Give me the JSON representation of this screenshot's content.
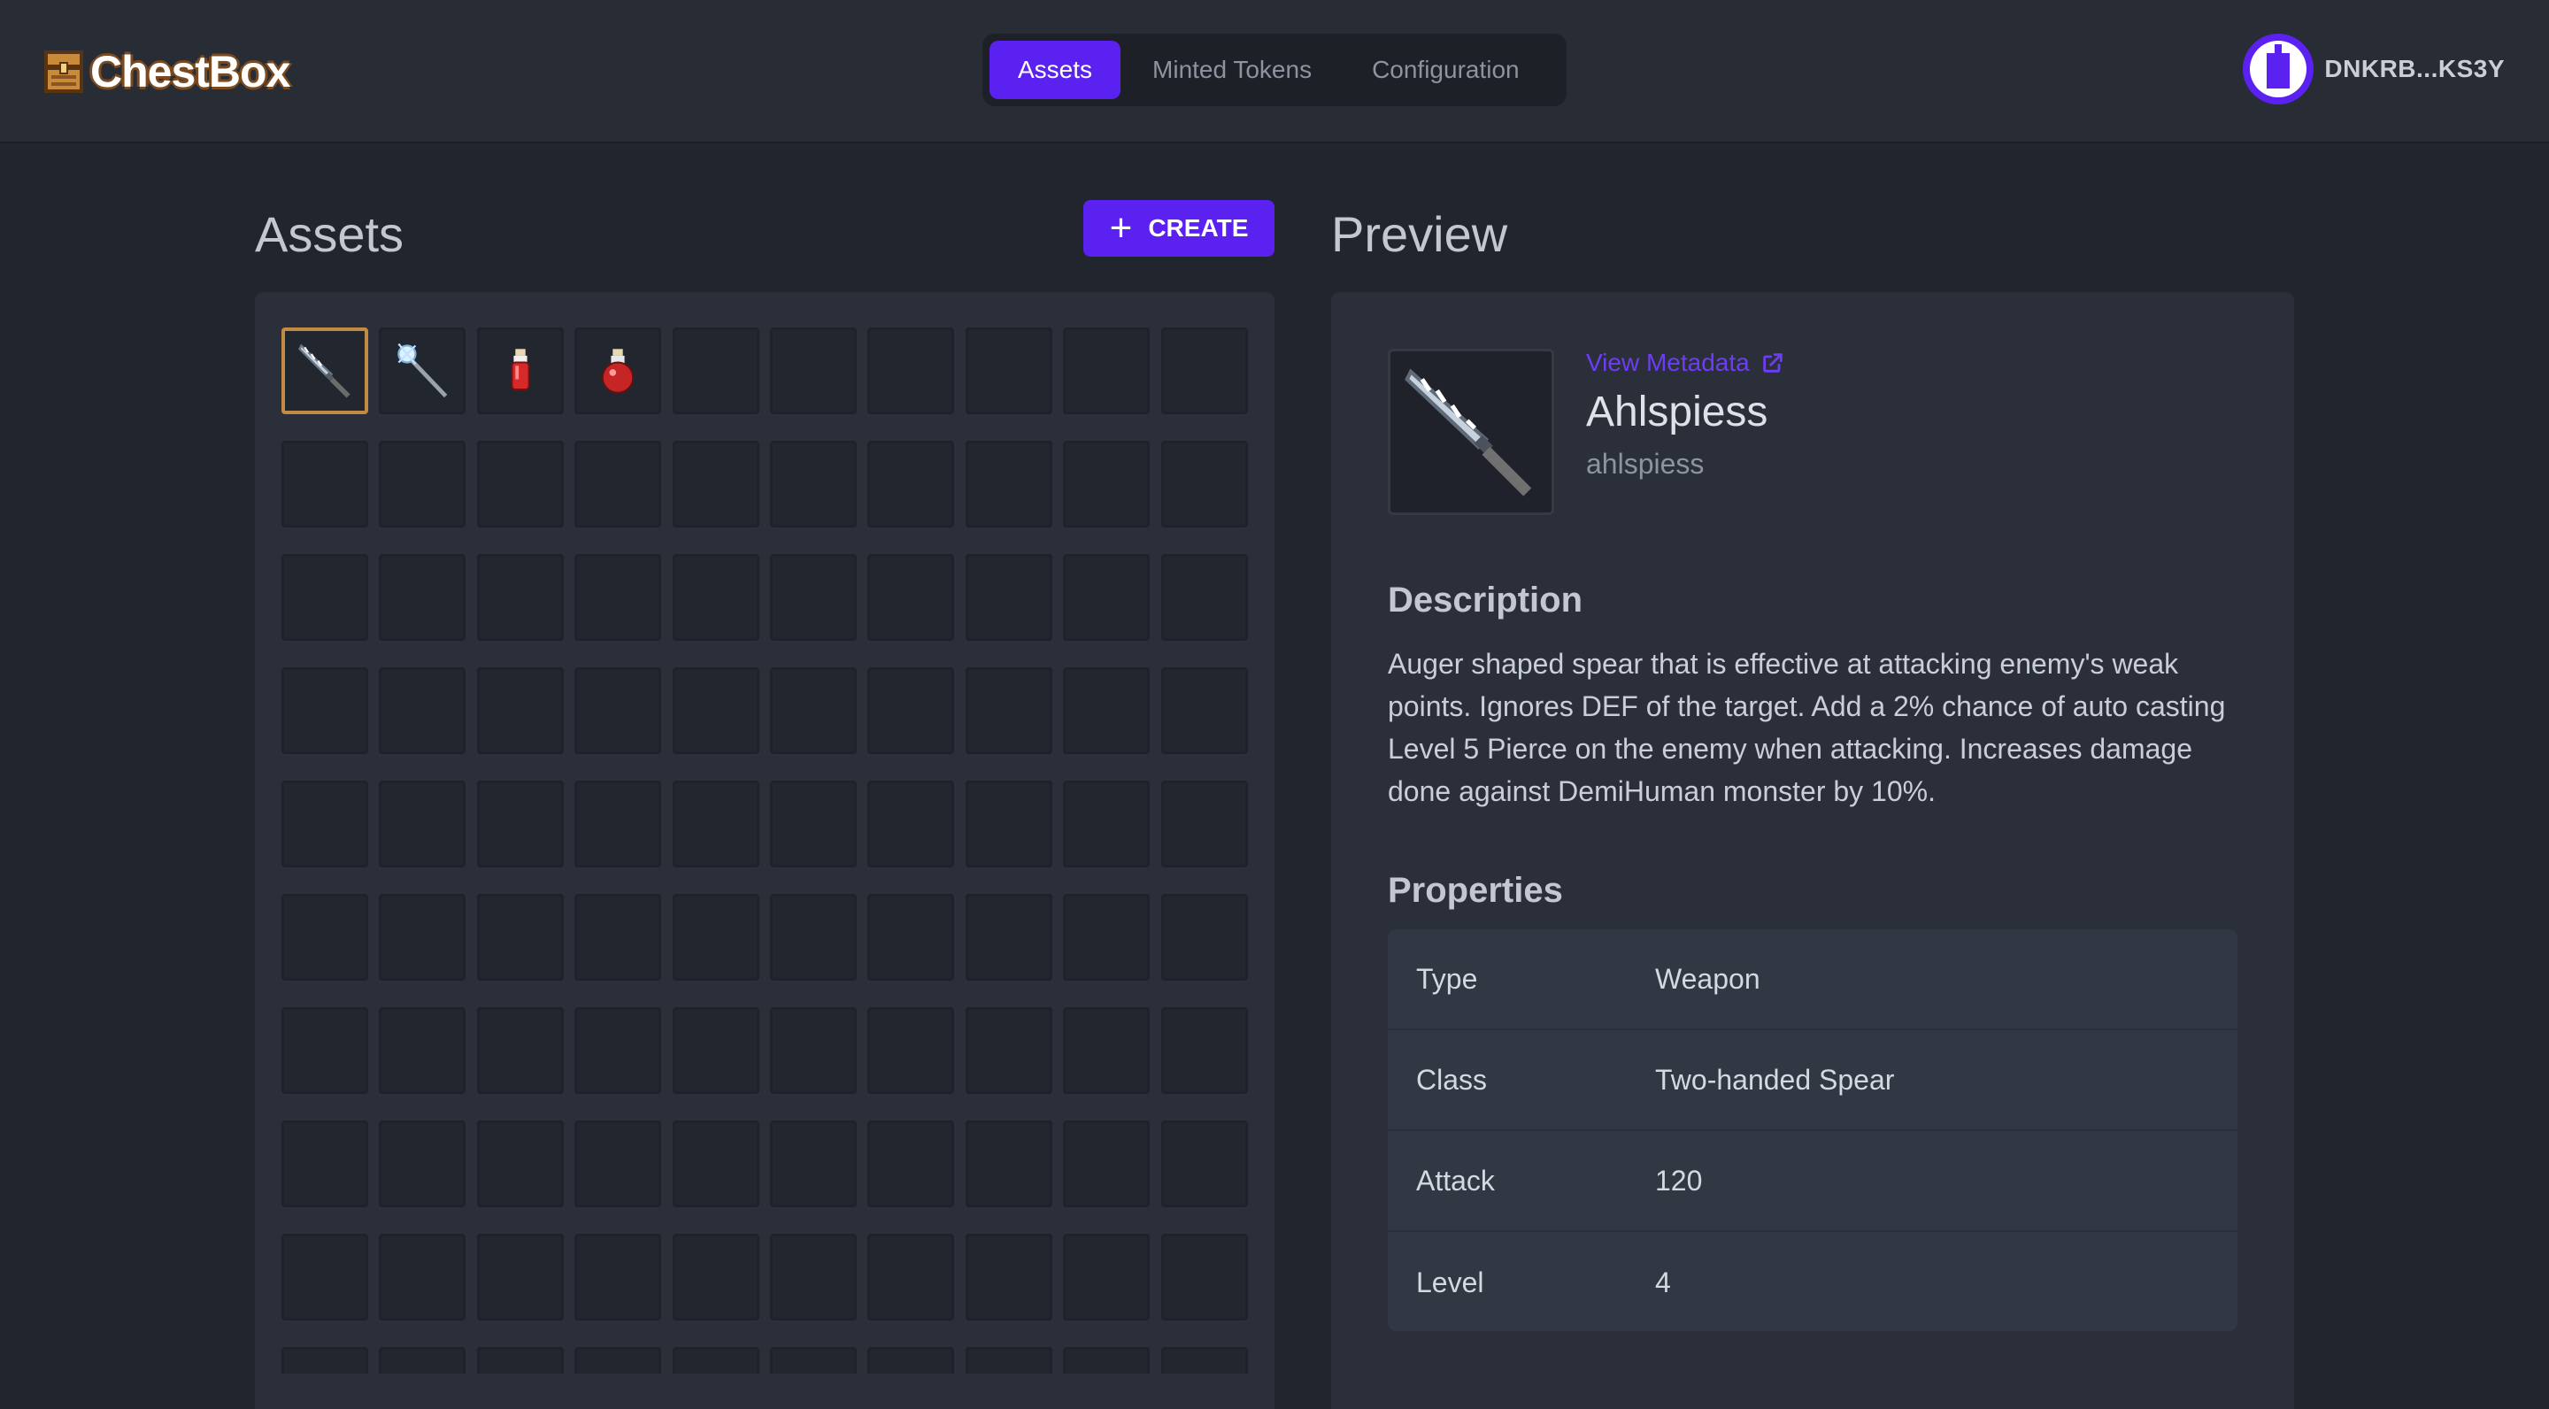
{
  "app": {
    "name": "ChestBox",
    "logo_icon": "treasure-chest-icon"
  },
  "nav": {
    "tabs": [
      {
        "label": "Assets",
        "active": true
      },
      {
        "label": "Minted Tokens",
        "active": false
      },
      {
        "label": "Configuration",
        "active": false
      }
    ]
  },
  "wallet": {
    "address": "DNKRB...KS3Y",
    "avatar_icon": "user-avatar-icon"
  },
  "assets": {
    "title": "Assets",
    "create_label": "CREATE",
    "slots": [
      {
        "icon": "spear-icon",
        "selected": true
      },
      {
        "icon": "staff-icon",
        "selected": false
      },
      {
        "icon": "red-potion-icon",
        "selected": false
      },
      {
        "icon": "round-potion-icon",
        "selected": false
      }
    ]
  },
  "preview": {
    "title": "Preview",
    "view_metadata": "View Metadata",
    "name": "Ahlspiess",
    "slug": "ahlspiess",
    "description_heading": "Description",
    "description": "Auger shaped spear that is effective at attacking enemy's weak points. Ignores DEF of the target. Add a 2% chance of auto casting Level 5 Pierce on the enemy when attacking. Increases damage done against DemiHuman monster by 10%.",
    "properties_heading": "Properties",
    "properties": [
      {
        "key": "Type",
        "value": "Weapon"
      },
      {
        "key": "Class",
        "value": "Two-handed Spear"
      },
      {
        "key": "Attack",
        "value": "120"
      },
      {
        "key": "Level",
        "value": "4"
      }
    ]
  },
  "colors": {
    "accent": "#5b21f0",
    "link": "#6d3df5",
    "selected_border": "#c28a42",
    "background": "#21252d",
    "panel": "#2b2f39"
  }
}
